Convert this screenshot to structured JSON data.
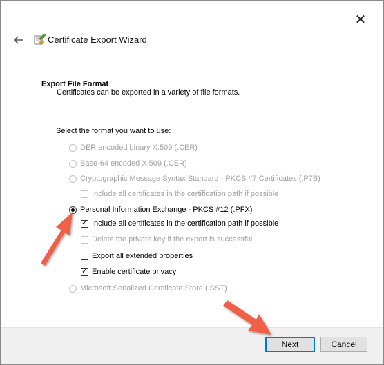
{
  "window": {
    "title": "Certificate Export Wizard",
    "close_glyph": "✕",
    "back_glyph": "🡐",
    "accent": "#0078d7"
  },
  "heading": {
    "title": "Export File Format",
    "subtitle": "Certificates can be exported in a variety of file formats."
  },
  "format": {
    "prompt": "Select the format you want to use:",
    "options": [
      {
        "label": "DER encoded binary X.509 (.CER)",
        "selected": false,
        "enabled": false
      },
      {
        "label": "Base-64 encoded X.509 (.CER)",
        "selected": false,
        "enabled": false
      },
      {
        "label": "Cryptographic Message Syntax Standard - PKCS #7 Certificates (.P7B)",
        "selected": false,
        "enabled": false
      },
      {
        "label": "Personal Information Exchange - PKCS #12 (.PFX)",
        "selected": true,
        "enabled": true
      },
      {
        "label": "Microsoft Serialized Certificate Store (.SST)",
        "selected": false,
        "enabled": false
      }
    ],
    "p7b_include_all": {
      "label": "Include all certificates in the certification path if possible",
      "checked": false,
      "enabled": false
    },
    "pfx_include_all": {
      "label": "Include all certificates in the certification path if possible",
      "checked": true,
      "enabled": true
    },
    "pfx_delete_key": {
      "label": "Delete the private key if the export is successful",
      "checked": false,
      "enabled": false
    },
    "pfx_export_ext": {
      "label": "Export all extended properties",
      "checked": false,
      "enabled": true
    },
    "pfx_privacy": {
      "label": "Enable certificate privacy",
      "checked": true,
      "enabled": true
    }
  },
  "buttons": {
    "next": "Next",
    "cancel": "Cancel"
  },
  "annotation_color": "#f0604a"
}
